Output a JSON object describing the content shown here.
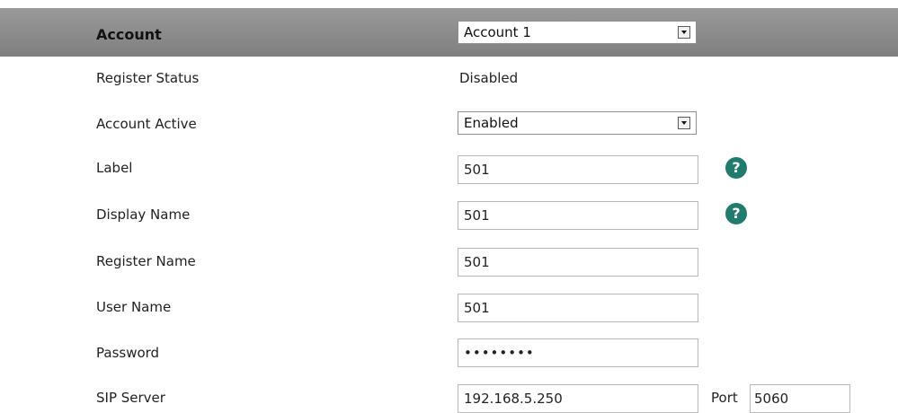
{
  "header": {
    "label": "Account",
    "account_select": "Account 1"
  },
  "rows": {
    "register_status": {
      "label": "Register Status",
      "value": "Disabled"
    },
    "account_active": {
      "label": "Account Active",
      "value": "Enabled"
    },
    "label": {
      "label": "Label",
      "value": "501"
    },
    "display_name": {
      "label": "Display Name",
      "value": "501"
    },
    "register_name": {
      "label": "Register Name",
      "value": "501"
    },
    "user_name": {
      "label": "User Name",
      "value": "501"
    },
    "password": {
      "label": "Password",
      "value": "••••••••"
    },
    "sip_server": {
      "label": "SIP Server",
      "value": "192.168.5.250",
      "port_label": "Port",
      "port_value": "5060"
    }
  },
  "icons": {
    "help": "question-mark-icon",
    "dropdown": "chevron-down-icon"
  },
  "colors": {
    "header_bar": "#8a8a8a",
    "help_icon": "#227b6f",
    "input_border": "#b9b9b9"
  }
}
